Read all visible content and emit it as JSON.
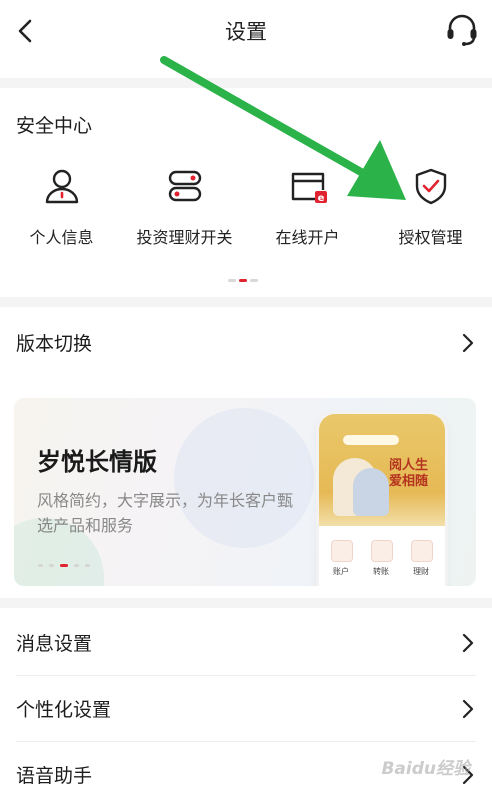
{
  "header": {
    "title": "设置",
    "back_icon": "chevron-left-icon",
    "service_icon": "headset-icon"
  },
  "security": {
    "title": "安全中心",
    "items": [
      {
        "label": "个人信息",
        "icon": "person-icon"
      },
      {
        "label": "投资理财开关",
        "icon": "toggle-switch-icon"
      },
      {
        "label": "在线开户",
        "icon": "card-e-icon"
      },
      {
        "label": "授权管理",
        "icon": "shield-check-icon"
      }
    ],
    "page_indicator": {
      "count": 3,
      "active": 1
    }
  },
  "version": {
    "label": "版本切换"
  },
  "banner": {
    "title": "岁悦长情版",
    "desc": "风格简约，大字展示，为年长客户甄选产品和服务",
    "page_indicator": {
      "count": 5,
      "active": 2
    },
    "phone": {
      "slogan": "阅人生 爱相随",
      "icon_labels": [
        "账户",
        "转账",
        "理财"
      ]
    }
  },
  "rows": [
    {
      "label": "消息设置"
    },
    {
      "label": "个性化设置"
    },
    {
      "label": "语音助手"
    }
  ],
  "watermark": "Baidu经验",
  "colors": {
    "accent_red": "#e0232e",
    "annotation_green": "#2bb34a",
    "gap_gray": "#f4f4f4",
    "text_primary": "#1d1d1d",
    "text_secondary": "#888888"
  }
}
